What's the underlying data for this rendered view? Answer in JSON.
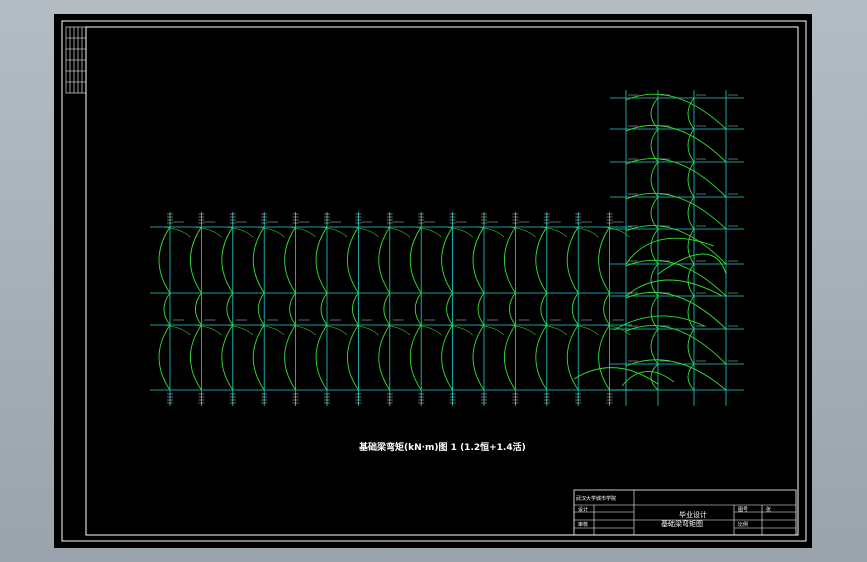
{
  "drawing": {
    "title": "基础梁弯矩(kN·m)图 1 (1.2恒+1.4活)",
    "colors": {
      "background": "#000000",
      "frame": "#ffffff",
      "grid": "#20d0d0",
      "moment_curve": "#30e030"
    }
  },
  "title_block": {
    "school": "武汉大学城市学院",
    "project": "毕业设计",
    "drawing_name": "基础梁弯矩图",
    "row_design": "设计",
    "row_review": "审核",
    "label_drawing_no": "图号",
    "label_scale": "比例",
    "label_sheet": "张"
  }
}
